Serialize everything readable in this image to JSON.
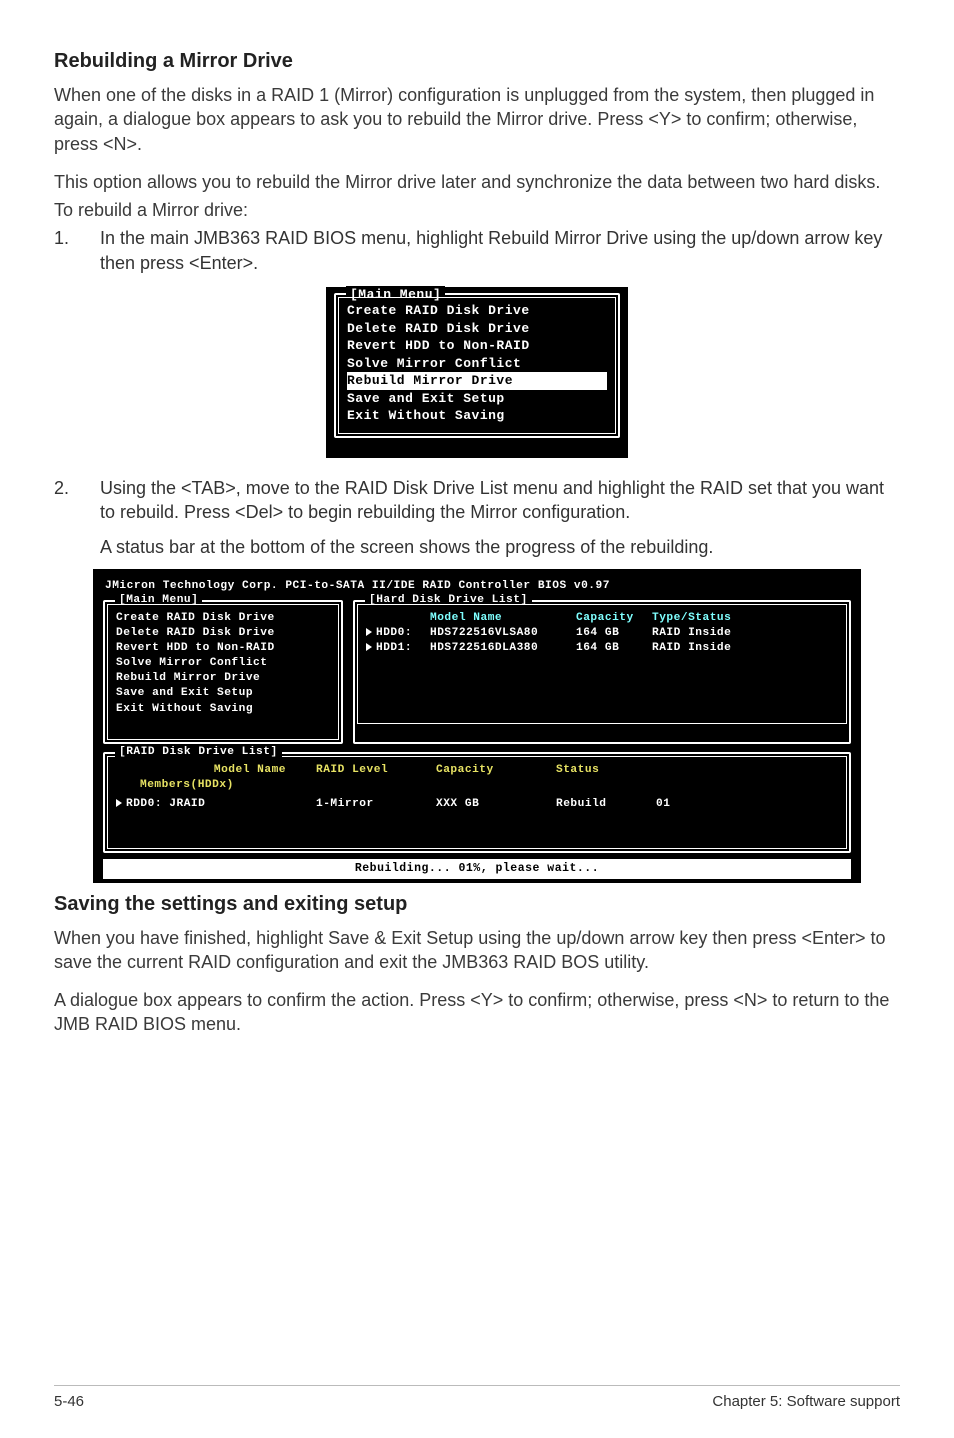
{
  "sections": {
    "rebuild_heading": "Rebuilding a Mirror Drive",
    "rebuild_p1": "When one of the disks in a RAID 1 (Mirror) configuration is unplugged from the system, then plugged in again, a dialogue box appears to ask you to rebuild the Mirror drive. Press <Y> to confirm; otherwise, press <N>.",
    "rebuild_p2": "This option allows you to rebuild the Mirror drive later and synchronize the data between two hard disks.",
    "rebuild_p3": "To rebuild a Mirror drive:",
    "step1_num": "1.",
    "step1_text": "In the main JMB363 RAID BIOS menu, highlight Rebuild Mirror Drive using the up/down arrow key then press <Enter>.",
    "step2_num": "2.",
    "step2_text": "Using the <TAB>, move to the RAID Disk Drive List menu and highlight the RAID set that you want to rebuild. Press <Del> to begin rebuilding the Mirror configuration.",
    "step2_sub": "A status bar at the bottom of the screen shows the progress of the rebuilding.",
    "saving_heading": "Saving the settings and exiting setup",
    "saving_p1": "When you have finished, highlight Save & Exit Setup using the up/down arrow key then press <Enter> to save the current RAID configuration and exit the JMB363 RAID BOS utility.",
    "saving_p2": "A dialogue box appears to confirm the action. Press <Y> to confirm; otherwise, press <N> to return to the JMB RAID BIOS menu."
  },
  "bios_small": {
    "legend": "[Main Menu]",
    "items": [
      "Create RAID Disk Drive",
      "Delete RAID Disk Drive",
      "Revert HDD to Non-RAID",
      "Solve Mirror Conflict",
      "Rebuild Mirror Drive",
      "Save and Exit Setup",
      "Exit Without Saving"
    ],
    "selected_index": 4
  },
  "bios_large": {
    "title": "JMicron Technology Corp. PCI-to-SATA II/IDE RAID Controller BIOS v0.97",
    "main_legend": "[Main Menu]",
    "main_items": [
      "Create RAID Disk Drive",
      "Delete RAID Disk Drive",
      "Revert HDD to Non-RAID",
      "Solve Mirror Conflict",
      "Rebuild Mirror Drive",
      "Save and Exit Setup",
      "Exit Without Saving"
    ],
    "hdd_legend": "[Hard Disk Drive List]",
    "hdd_header": {
      "c1": "",
      "c2": "Model Name",
      "c3": "Capacity",
      "c4": "Type/Status"
    },
    "hdd_rows": [
      {
        "c1": "HDD0:",
        "c2": "HDS722516VLSA80",
        "c3": "164 GB",
        "c4": "RAID Inside"
      },
      {
        "c1": "HDD1:",
        "c2": "HDS722516DLA380",
        "c3": "164 GB",
        "c4": "RAID Inside"
      }
    ],
    "raid_legend": "[RAID Disk Drive List]",
    "raid_header": {
      "c1": "Model Name",
      "c2": "RAID Level",
      "c3": "Capacity",
      "c4": "Status",
      "c5": ""
    },
    "raid_sub": "Members(HDDx)",
    "raid_row": {
      "c1": "RDD0:  JRAID",
      "c2": "1-Mirror",
      "c3": "XXX GB",
      "c4": "Rebuild",
      "c5": "01"
    },
    "status_bar": "Rebuilding... 01%, please wait..."
  },
  "footer": {
    "left": "5-46",
    "right": "Chapter 5: Software support"
  }
}
